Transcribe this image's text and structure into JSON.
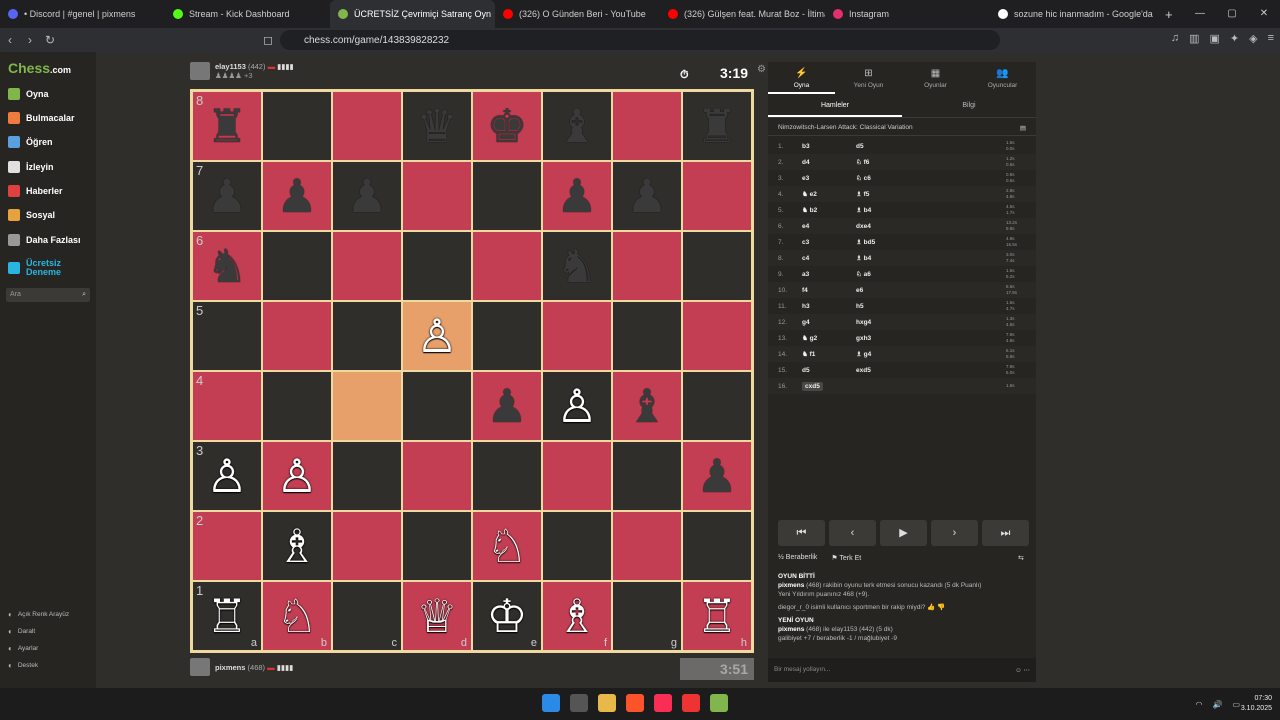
{
  "tabs": [
    {
      "label": "• Discord | #genel | pixmens",
      "color": "#5865f2"
    },
    {
      "label": "Stream - Kick Dashboard",
      "color": "#53fc18"
    },
    {
      "label": "ÜCRETSİZ Çevrimiçi Satranç Oyn",
      "color": "#81b64c",
      "active": true
    },
    {
      "label": "(326) O Günden Beri - YouTube",
      "color": "#ff0000"
    },
    {
      "label": "(326) Gülşen feat. Murat Boz - İltima",
      "color": "#ff0000"
    },
    {
      "label": "Instagram",
      "color": "#e1306c"
    },
    {
      "label": "sozune hic inanmadım - Google'da /",
      "color": "#ffffff"
    }
  ],
  "url": "chess.com/game/143839828232",
  "sidebar": {
    "logo_a": "Chess",
    "logo_b": ".com",
    "items": [
      {
        "label": "Oyna",
        "color": "#81b64c"
      },
      {
        "label": "Bulmacalar",
        "color": "#f07b3f"
      },
      {
        "label": "Öğren",
        "color": "#5aa0e0"
      },
      {
        "label": "İzleyin",
        "color": "#e0e0e0"
      },
      {
        "label": "Haberler",
        "color": "#e04040"
      },
      {
        "label": "Sosyal",
        "color": "#e6a23c"
      },
      {
        "label": "Daha Fazlası",
        "color": "#999999"
      },
      {
        "label": "Ücretsiz Deneme",
        "color": "#2ab5e0"
      }
    ],
    "search_placeholder": "Ara",
    "footer": [
      "Açık Renk Arayüz",
      "Daralt",
      "Ayarlar",
      "Destek"
    ]
  },
  "top_player": {
    "name": "elay1153",
    "rating": "(442)",
    "extra": "+3"
  },
  "bottom_player": {
    "name": "pixmens",
    "rating": "(468)"
  },
  "top_clock": "3:19",
  "bottom_clock": "3:51",
  "board": [
    [
      "♜",
      "",
      "",
      "♛",
      "♚",
      "♝",
      "",
      "♜"
    ],
    [
      "♟",
      "♟",
      "♟",
      "",
      "",
      "♟",
      "♟",
      ""
    ],
    [
      "♞",
      "",
      "",
      "",
      "",
      "♞",
      "",
      ""
    ],
    [
      "",
      "",
      "",
      "♙",
      "",
      "",
      "",
      ""
    ],
    [
      "",
      "",
      "",
      "",
      "♟",
      "♙",
      "♝",
      ""
    ],
    [
      "♙",
      "♙",
      "",
      "",
      "",
      "",
      "",
      "♟"
    ],
    [
      "",
      "♗",
      "",
      "",
      "♘",
      "",
      "",
      ""
    ],
    [
      "♖",
      "♘",
      "",
      "♕",
      "♔",
      "♗",
      "",
      "♖"
    ]
  ],
  "panel": {
    "tabs": [
      "Oyna",
      "Yeni Oyun",
      "Oyunlar",
      "Oyuncular"
    ],
    "subtabs": [
      "Hamleler",
      "Bilgi"
    ],
    "opening": "Nimzowitsch-Larsen Attack: Classical Variation",
    "moves": [
      {
        "n": "1.",
        "w": "b3",
        "b": "d5",
        "t1": "1.6s",
        "t2": "0.0s"
      },
      {
        "n": "2.",
        "w": "d4",
        "b": "♘ f6",
        "t1": "1.2s",
        "t2": "0.6s"
      },
      {
        "n": "3.",
        "w": "e3",
        "b": "♘ c6",
        "t1": "0.9s",
        "t2": "0.6s"
      },
      {
        "n": "4.",
        "w": "♞ e2",
        "b": "♗ f5",
        "t1": "2.8s",
        "t2": "4.8s"
      },
      {
        "n": "5.",
        "w": "♞ b2",
        "b": "♗ b4",
        "t1": "4.5s",
        "t2": "1.7s"
      },
      {
        "n": "6.",
        "w": "e4",
        "b": "dxe4",
        "t1": "13.2s",
        "t2": "9.8s"
      },
      {
        "n": "7.",
        "w": "c3",
        "b": "♗ bd5",
        "t1": "4.9s",
        "t2": "16.5s"
      },
      {
        "n": "8.",
        "w": "c4",
        "b": "♗ b4",
        "t1": "3.0s",
        "t2": "7.4s"
      },
      {
        "n": "9.",
        "w": "a3",
        "b": "♘ a6",
        "t1": "1.6s",
        "t2": "5.2s"
      },
      {
        "n": "10.",
        "w": "f4",
        "b": "e6",
        "t1": "8.6s",
        "t2": "17.8s"
      },
      {
        "n": "11.",
        "w": "h3",
        "b": "h5",
        "t1": "1.6s",
        "t2": "4.7s"
      },
      {
        "n": "12.",
        "w": "g4",
        "b": "hxg4",
        "t1": "1.3s",
        "t2": "4.5s"
      },
      {
        "n": "13.",
        "w": "♞ g2",
        "b": "gxh3",
        "t1": "7.9s",
        "t2": "4.8s"
      },
      {
        "n": "14.",
        "w": "♞ f1",
        "b": "♗ g4",
        "t1": "6.1s",
        "t2": "5.9s"
      },
      {
        "n": "15.",
        "w": "d5",
        "b": "exd5",
        "t1": "7.9s",
        "t2": "6.0s"
      },
      {
        "n": "16.",
        "w": "cxd5",
        "b": "",
        "t1": "1.5s",
        "t2": ""
      }
    ],
    "draw": "Beraberlik",
    "resign": "Terk Et",
    "chat": [
      {
        "b": "OYUN BİTTİ",
        "t": ""
      },
      {
        "b": "pixmens",
        "t": " (468) rakibin oyunu terk etmesi sonucu kazandı (5 dk Puanlı)"
      },
      {
        "b": "",
        "t": "Yeni Yıldırım puanınız 468 (+9)."
      },
      {
        "b": "",
        "t": ""
      },
      {
        "b": "",
        "t": "diegor_r_0 isimli kullanıcı sportmen bir rakip miydi?"
      },
      {
        "b": "",
        "t": ""
      },
      {
        "b": "YENİ OYUN",
        "t": ""
      },
      {
        "b": "pixmens",
        "t": " (468) ile elay1153 (442) (5 dk)"
      },
      {
        "b": "",
        "t": "galibiyet +7 / beraberlik -1 / mağlubiyet -9"
      }
    ],
    "message_placeholder": "Bir mesaj yollayın..."
  },
  "taskbar": {
    "time": "07:30",
    "date": "3.10.2025"
  }
}
